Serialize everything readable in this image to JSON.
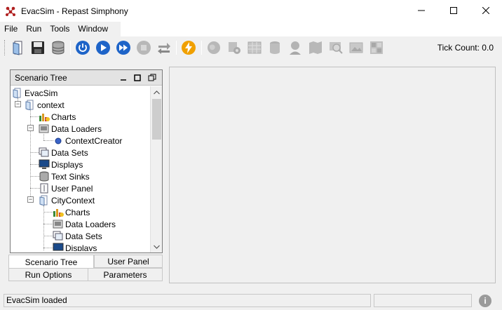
{
  "window": {
    "title": "EvacSim - Repast Simphony"
  },
  "menu": {
    "items": [
      "File",
      "Run",
      "Tools",
      "Window"
    ]
  },
  "toolbar": {
    "tick_count": "Tick Count: 0.0",
    "icons": [
      "open-icon",
      "save-icon",
      "database-icon",
      "power-icon",
      "play-icon",
      "fast-forward-icon",
      "stop-icon",
      "reset-icon",
      "lightning-icon",
      "globe-icon",
      "settings-gear-icon",
      "table-icon",
      "database-export-icon",
      "person-icon",
      "map-icon",
      "search-icon",
      "picture-icon",
      "grid-icon"
    ]
  },
  "scenario": {
    "title": "Scenario Tree",
    "tree": [
      {
        "label": "EvacSim",
        "icon": "document-icon"
      },
      {
        "label": "context",
        "icon": "document-icon"
      },
      {
        "label": "Charts",
        "icon": "chart-icon"
      },
      {
        "label": "Data Loaders",
        "icon": "data-loader-icon"
      },
      {
        "label": "ContextCreator",
        "icon": "bullet-icon"
      },
      {
        "label": "Data Sets",
        "icon": "data-set-icon"
      },
      {
        "label": "Displays",
        "icon": "monitor-icon"
      },
      {
        "label": "Text Sinks",
        "icon": "database-icon"
      },
      {
        "label": "User Panel",
        "icon": "panel-icon"
      },
      {
        "label": "CityContext",
        "icon": "document-icon"
      },
      {
        "label": "Charts",
        "icon": "chart-icon"
      },
      {
        "label": "Data Loaders",
        "icon": "data-loader-icon"
      },
      {
        "label": "Data Sets",
        "icon": "data-set-icon"
      },
      {
        "label": "Displays",
        "icon": "monitor-icon"
      }
    ]
  },
  "tabs": {
    "scenario_tree": "Scenario Tree",
    "user_panel": "User Panel",
    "run_options": "Run Options",
    "parameters": "Parameters"
  },
  "status": {
    "message": "EvacSim loaded"
  }
}
